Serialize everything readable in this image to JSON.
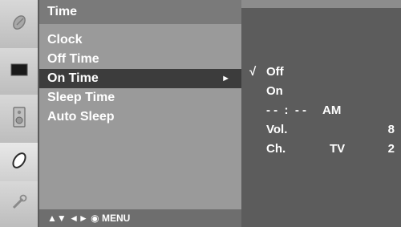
{
  "colors": {
    "panel_bg": "#9a9a9a",
    "panel_title_bg": "#7a7a7a",
    "selected_bg": "#3c3c3c",
    "submenu_bg": "#5c5c5c",
    "text": "#ffffff"
  },
  "sidebar": {
    "icons": [
      "satellite-dish-icon",
      "screen-icon",
      "speaker-icon",
      "clock-icon",
      "tool-icon"
    ]
  },
  "menu": {
    "title": "Time",
    "items": [
      {
        "label": "Clock"
      },
      {
        "label": "Off Time"
      },
      {
        "label": "On Time",
        "arrow": "►"
      },
      {
        "label": "Sleep Time"
      },
      {
        "label": "Auto Sleep"
      }
    ]
  },
  "footer": {
    "nav": "▲▼  ◄►  ◉  MENU"
  },
  "submenu": {
    "check": "√",
    "off": "Off",
    "on": "On",
    "time_placeholder": "- -  :  - -",
    "ampm": "AM",
    "vol_label": "Vol.",
    "vol_value": "8",
    "ch_label": "Ch.",
    "ch_source": "TV",
    "ch_value": "2"
  }
}
